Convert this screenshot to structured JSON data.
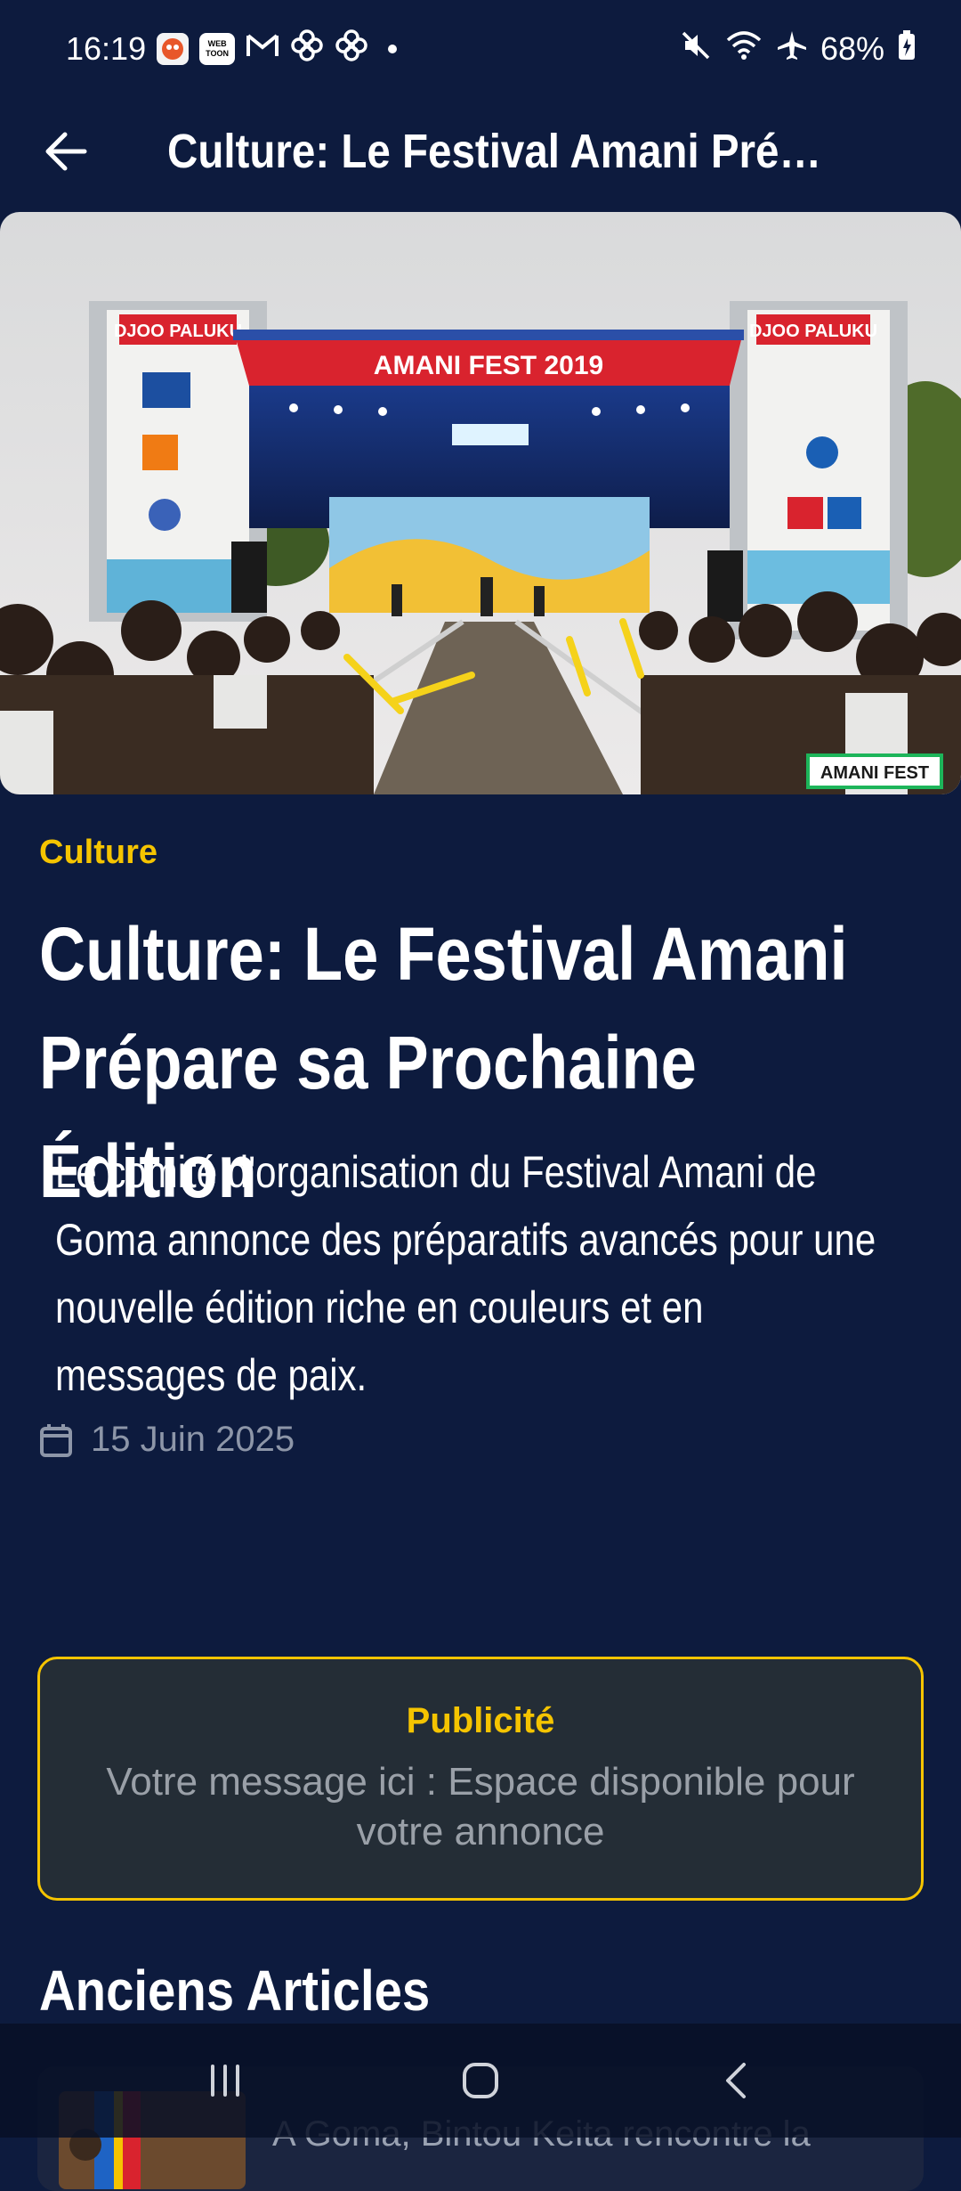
{
  "status_bar": {
    "time": "16:19",
    "battery": "68%",
    "notification_icons": [
      "brawl-icon",
      "webtoon-icon",
      "gmail-icon",
      "pinwheel-icon",
      "pinwheel-icon"
    ],
    "webtoon_text": "WEB TOON",
    "system_icons": [
      "mute-icon",
      "wifi-icon",
      "airplane-icon",
      "battery-icon"
    ]
  },
  "app_bar": {
    "title": "Culture: Le Festival Amani Prépar..."
  },
  "hero": {
    "banner_text": "AMANI FEST 2019",
    "tower_text": "DJOO PALUKU",
    "watermark": "AMANI FEST"
  },
  "article": {
    "category": "Culture",
    "title": "Culture: Le Festival Amani Prépare sa Prochaine Édition",
    "summary": "Le comité d'organisation du Festival Amani de Goma annonce des préparatifs avancés pour une nouvelle édition riche en couleurs et en messages de paix.",
    "date": "15 Juin 2025"
  },
  "ad": {
    "label": "Publicité",
    "text": "Votre message ici : Espace disponible pour votre annonce"
  },
  "older_articles": {
    "title": "Anciens Articles",
    "items": [
      {
        "title": "A Goma, Bintou Keita rencontre la"
      }
    ]
  },
  "colors": {
    "background": "#0d1b3e",
    "accent": "#f5c400",
    "ad_background": "#242d36",
    "muted_text": "#8d96a8"
  }
}
